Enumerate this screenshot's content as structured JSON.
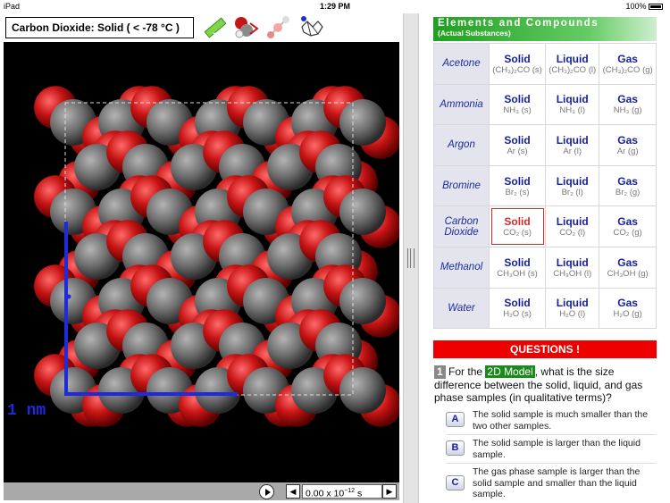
{
  "status": {
    "device": "iPad",
    "time": "1:29 PM",
    "battery": "100%"
  },
  "sample_title": "Carbon Dioxide: Solid ( < -78 °C )",
  "toolbar_icons": [
    "ruler-icon",
    "molecule-model-icon",
    "ball-and-stick-icon",
    "network-structure-icon"
  ],
  "scale_label": "1 nm",
  "time_base": "0.00 x 10",
  "time_exp": "−12",
  "time_unit": " s",
  "elements": {
    "title": "Elements and Compounds",
    "subtitle": "(Actual Substances)",
    "rows": [
      {
        "name": "Acetone",
        "solid": "Solid",
        "liquid": "Liquid",
        "gas": "Gas",
        "fs": "(CH₃)₂CO (s)",
        "fl": "(CH₃)₂CO (l)",
        "fg": "(CH₃)₂CO (g)"
      },
      {
        "name": "Ammonia",
        "solid": "Solid",
        "liquid": "Liquid",
        "gas": "Gas",
        "fs": "NH₃ (s)",
        "fl": "NH₃ (l)",
        "fg": "NH₃ (g)"
      },
      {
        "name": "Argon",
        "solid": "Solid",
        "liquid": "Liquid",
        "gas": "Gas",
        "fs": "Ar (s)",
        "fl": "Ar (l)",
        "fg": "Ar (g)"
      },
      {
        "name": "Bromine",
        "solid": "Solid",
        "liquid": "Liquid",
        "gas": "Gas",
        "fs": "Br₂ (s)",
        "fl": "Br₂ (l)",
        "fg": "Br₂ (g)"
      },
      {
        "name": "Carbon Dioxide",
        "solid": "Solid",
        "liquid": "Liquid",
        "gas": "Gas",
        "fs": "CO₂ (s)",
        "fl": "CO₂ (l)",
        "fg": "CO₂ (g)"
      },
      {
        "name": "Methanol",
        "solid": "Solid",
        "liquid": "Liquid",
        "gas": "Gas",
        "fs": "CH₃OH (s)",
        "fl": "CH₃OH (l)",
        "fg": "CH₃OH (g)"
      },
      {
        "name": "Water",
        "solid": "Solid",
        "liquid": "Liquid",
        "gas": "Gas",
        "fs": "H₂O (s)",
        "fl": "H₂O (l)",
        "fg": "H₂O (g)"
      }
    ]
  },
  "questions": {
    "header": "QUESTIONS !",
    "q1": {
      "number": "1",
      "pre": "For the",
      "highlight": "2D Model",
      "post": ", what is the size difference between the solid, liquid, and gas phase samples (in qualitative terms)?"
    },
    "answers": [
      {
        "key": "A",
        "text": "The solid sample is much smaller than the two other samples."
      },
      {
        "key": "B",
        "text": "The solid sample is larger than the liquid sample."
      },
      {
        "key": "C",
        "text": "The gas phase sample is larger than the solid sample and smaller than the liquid sample."
      }
    ]
  },
  "colors": {
    "oxygen": "#c81414",
    "carbon": "#6e6e6e",
    "scale_bar": "#1d2bdb",
    "selected": "#d42a2a",
    "header_green": "#1f9f1f",
    "questions_red": "#ee0000"
  }
}
